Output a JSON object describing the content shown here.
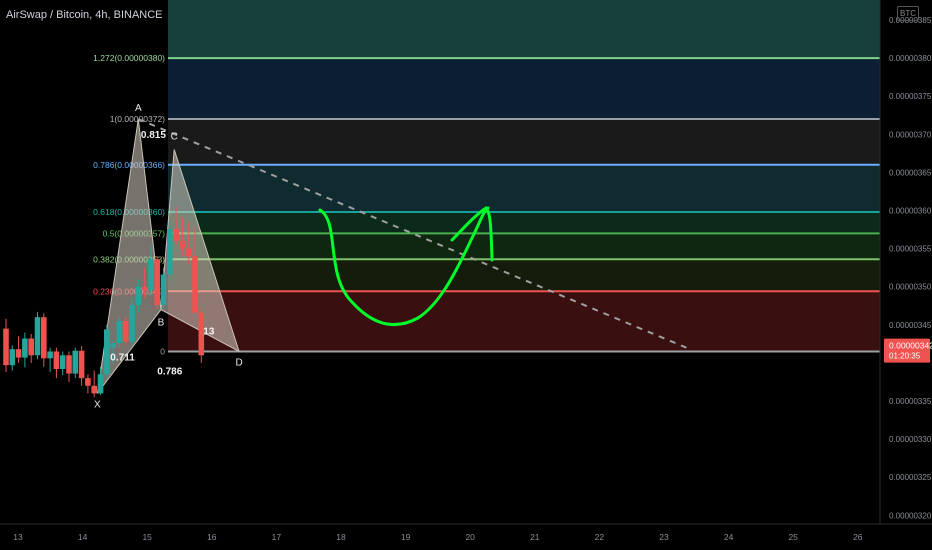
{
  "header": {
    "title": "AirSwap / Bitcoin, 4h, BINANCE",
    "currency_badge": "BTC"
  },
  "colors": {
    "background": "#000000",
    "up_candle": "#26a69a",
    "down_candle": "#ef5350",
    "drawing": "#00ff2a",
    "price_badge": "#ef5350",
    "pattern_fill": "#d8d2c4"
  },
  "chart_data": {
    "type": "candlestick",
    "symbol": "AirSwap / Bitcoin",
    "interval": "4h",
    "exchange": "BINANCE",
    "x_tick_labels": [
      "13",
      "14",
      "15",
      "16",
      "17",
      "18",
      "19",
      "20",
      "21",
      "22",
      "23",
      "24",
      "25",
      "26"
    ],
    "y_tick_labels": [
      "0.00000385",
      "0.00000380",
      "0.00000375",
      "0.00000370",
      "0.00000365",
      "0.00000360",
      "0.00000355",
      "0.00000350",
      "0.00000345",
      "0.00000335",
      "0.00000330",
      "0.00000325",
      "0.00000320"
    ],
    "ylim": [
      3.175e-06,
      3.875e-06
    ],
    "current_price": {
      "label": "0.00000342",
      "countdown": "01:20:35",
      "value": 3.42e-06
    },
    "candles": [
      {
        "o": 344.5,
        "h": 345.8,
        "l": 338.8,
        "c": 339.7
      },
      {
        "o": 339.7,
        "h": 342.3,
        "l": 339.0,
        "c": 341.8
      },
      {
        "o": 341.8,
        "h": 343.5,
        "l": 340.0,
        "c": 340.7
      },
      {
        "o": 340.7,
        "h": 344.0,
        "l": 339.4,
        "c": 343.2
      },
      {
        "o": 343.2,
        "h": 343.8,
        "l": 340.0,
        "c": 341.0
      },
      {
        "o": 341.0,
        "h": 346.7,
        "l": 340.5,
        "c": 346.0
      },
      {
        "o": 346.0,
        "h": 346.5,
        "l": 339.5,
        "c": 340.6
      },
      {
        "o": 340.6,
        "h": 342.0,
        "l": 338.8,
        "c": 341.5
      },
      {
        "o": 341.5,
        "h": 342.0,
        "l": 338.0,
        "c": 339.2
      },
      {
        "o": 339.2,
        "h": 341.5,
        "l": 338.4,
        "c": 341.0
      },
      {
        "o": 341.0,
        "h": 341.5,
        "l": 337.5,
        "c": 338.6
      },
      {
        "o": 338.6,
        "h": 342.0,
        "l": 338.0,
        "c": 341.6
      },
      {
        "o": 341.6,
        "h": 342.2,
        "l": 337.0,
        "c": 338.0
      },
      {
        "o": 338.0,
        "h": 338.5,
        "l": 336.0,
        "c": 337.0
      },
      {
        "o": 337.0,
        "h": 339.0,
        "l": 335.5,
        "c": 336.0
      },
      {
        "o": 336.0,
        "h": 339.5,
        "l": 335.8,
        "c": 338.5
      },
      {
        "o": 338.5,
        "h": 345.0,
        "l": 338.0,
        "c": 344.4
      },
      {
        "o": 342.0,
        "h": 343.0,
        "l": 340.0,
        "c": 342.6
      },
      {
        "o": 342.6,
        "h": 346.0,
        "l": 342.0,
        "c": 345.5
      },
      {
        "o": 345.5,
        "h": 346.0,
        "l": 342.3,
        "c": 342.8
      },
      {
        "o": 342.8,
        "h": 348.5,
        "l": 342.3,
        "c": 347.6
      },
      {
        "o": 347.6,
        "h": 351.0,
        "l": 346.5,
        "c": 350.0
      },
      {
        "o": 350.0,
        "h": 352.5,
        "l": 348.5,
        "c": 349.6
      },
      {
        "o": 349.6,
        "h": 355.5,
        "l": 349.0,
        "c": 353.6
      },
      {
        "o": 353.6,
        "h": 354.0,
        "l": 347.0,
        "c": 347.6
      },
      {
        "o": 347.6,
        "h": 352.5,
        "l": 347.0,
        "c": 351.6
      },
      {
        "o": 351.6,
        "h": 358.5,
        "l": 350.8,
        "c": 357.6
      },
      {
        "o": 357.6,
        "h": 360.5,
        "l": 355.5,
        "c": 356.0
      },
      {
        "o": 356.0,
        "h": 359.0,
        "l": 354.0,
        "c": 355.0
      },
      {
        "o": 355.0,
        "h": 358.5,
        "l": 353.0,
        "c": 354.0
      },
      {
        "o": 354.0,
        "h": 358.0,
        "l": 348.0,
        "c": 346.6
      },
      {
        "o": 346.6,
        "h": 347.5,
        "l": 340.0,
        "c": 341.0
      }
    ],
    "fibonacci": {
      "levels": [
        {
          "ratio": 1.272,
          "label": "1.272(0.00000380)",
          "price": 380.0,
          "line_color": "#7fd38a",
          "text_color": "#9ed8a0",
          "zone_fill": "#173f3b"
        },
        {
          "ratio": 1,
          "label": "1(0.00000372)",
          "price": 372.0,
          "line_color": "#9aa0a6",
          "text_color": "#b0b4ba",
          "zone_fill": "#0b1e33"
        },
        {
          "ratio": 0.786,
          "label": "0.786(0.00000366)",
          "price": 366.0,
          "line_color": "#6ab0ff",
          "text_color": "#6ab0ff",
          "zone_fill": "#1a1a1a"
        },
        {
          "ratio": 0.618,
          "label": "0.618(0.00000360)",
          "price": 359.8,
          "line_color": "#18a39a",
          "text_color": "#18b8a8",
          "zone_fill": "#0f2b2f"
        },
        {
          "ratio": 0.5,
          "label": "0.5(0.00000357)",
          "price": 357.0,
          "line_color": "#4caf50",
          "text_color": "#5fc766",
          "zone_fill": "#0b2a1a"
        },
        {
          "ratio": 0.382,
          "label": "0.382(0.00000353)",
          "price": 353.6,
          "line_color": "#7cc16a",
          "text_color": "#8fd07a",
          "zone_fill": "#0f2610"
        },
        {
          "ratio": 0.236,
          "label": "0.236(0.00000349)",
          "price": 349.4,
          "line_color": "#ef5350",
          "text_color": "#ef5350",
          "zone_fill": "#141c0c"
        },
        {
          "ratio": 0,
          "label": "0",
          "price": 341.5,
          "line_color": "#9aa0a6",
          "text_color": "#9aa0a6",
          "zone_fill": "#3a0f10"
        }
      ]
    },
    "harmonic_pattern": {
      "points": [
        {
          "label": "X",
          "candle": 14.5,
          "price": 336.0
        },
        {
          "label": "A",
          "candle": 21.0,
          "price": 372.0
        },
        {
          "label": "B",
          "candle": 24.6,
          "price": 347.0
        },
        {
          "label": "C",
          "candle": 26.7,
          "price": 368.0
        },
        {
          "label": "D",
          "candle": 37.0,
          "price": 341.5
        }
      ],
      "ratio_labels": [
        {
          "text": "0.815",
          "candle": 23.4,
          "price": 369.5
        },
        {
          "text": "0.711",
          "candle": 18.5,
          "price": 340.3
        },
        {
          "text": "0.786",
          "candle": 26.0,
          "price": 338.5
        },
        {
          "text": "13",
          "candle": 32.2,
          "price": 343.7
        }
      ]
    },
    "trendline": {
      "from": {
        "candle": 21.0,
        "price": 372.0
      },
      "to": {
        "candle": 108.0,
        "price": 342.0
      },
      "style": "dashed"
    },
    "grid": false
  }
}
